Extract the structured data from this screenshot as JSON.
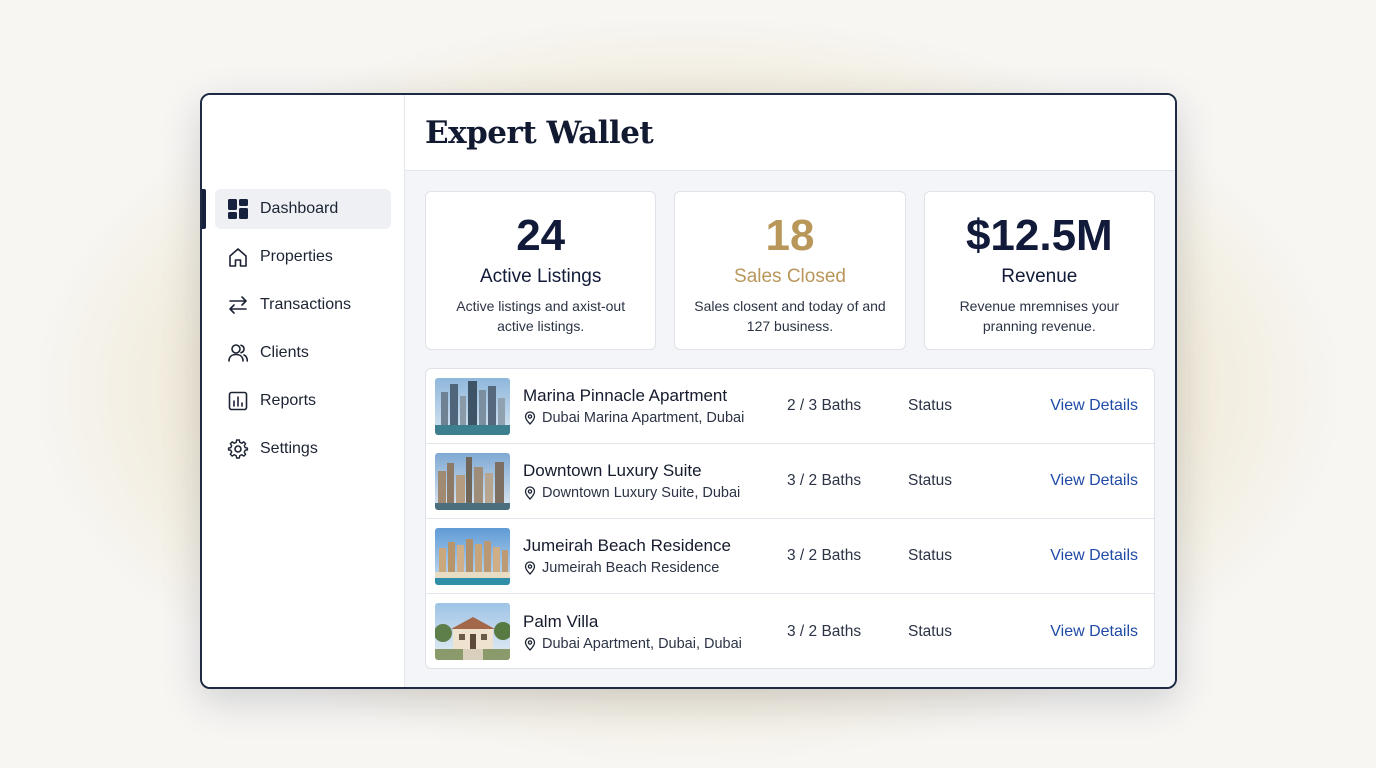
{
  "app": {
    "title": "Expert Wallet"
  },
  "sidebar": {
    "items": [
      {
        "label": "Dashboard",
        "icon": "dashboard-icon",
        "active": true
      },
      {
        "label": "Properties",
        "icon": "home-icon",
        "active": false
      },
      {
        "label": "Transactions",
        "icon": "transfer-arrows-icon",
        "active": false
      },
      {
        "label": "Clients",
        "icon": "users-icon",
        "active": false
      },
      {
        "label": "Reports",
        "icon": "bar-chart-icon",
        "active": false
      },
      {
        "label": "Settings",
        "icon": "gear-icon",
        "active": false
      }
    ]
  },
  "stats": [
    {
      "value": "24",
      "label": "Active Listings",
      "desc": "Active listings and axist-out active listings.",
      "color": "#111a38"
    },
    {
      "value": "18",
      "label": "Sales Closed",
      "desc": "Sales closent and today of and 127 business.",
      "color": "#b9975b"
    },
    {
      "value": "$12.5M",
      "label": "Revenue",
      "desc": "Revenue mremnises your pranning revenue.",
      "color": "#111a38"
    }
  ],
  "listings": [
    {
      "name": "Marina Pinnacle Apartment",
      "location": "Dubai Marina Apartment, Dubai",
      "baths": "2 / 3 Baths",
      "status": "Status",
      "action": "View Details",
      "image": "marina-towers-photo"
    },
    {
      "name": "Downtown Luxury Suite",
      "location": "Downtown Luxury Suite, Dubai",
      "baths": "3 / 2 Baths",
      "status": "Status",
      "action": "View Details",
      "image": "downtown-skyline-photo"
    },
    {
      "name": "Jumeirah Beach Residence",
      "location": "Jumeirah Beach Residence",
      "baths": "3 / 2 Baths",
      "status": "Status",
      "action": "View Details",
      "image": "beach-towers-photo"
    },
    {
      "name": "Palm Villa",
      "location": "Dubai Apartment, Dubai, Dubai",
      "baths": "3 / 2 Baths",
      "status": "Status",
      "action": "View Details",
      "image": "villa-photo"
    }
  ],
  "colors": {
    "accent": "#15213d",
    "gold": "#b9975b",
    "link": "#1f4aa6"
  }
}
